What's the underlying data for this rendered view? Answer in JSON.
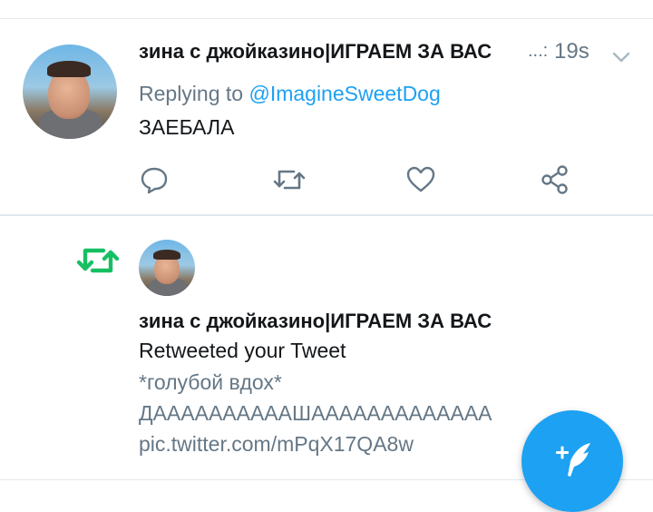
{
  "tweet": {
    "author_name": "зина с джойказино|ИГРАЕМ ЗА ВАС",
    "ellipsis": "...:",
    "timestamp": "19s",
    "replying_prefix": "Replying to",
    "replying_handle": "@ImagineSweetDog",
    "text": "ЗАЕБАЛА",
    "actions": [
      "reply-icon",
      "retweet-icon",
      "like-icon",
      "share-icon"
    ]
  },
  "notification": {
    "type_icon": "retweet-icon",
    "author_name": "зина с джойказино|ИГРАЕМ ЗА ВАС",
    "action_text": "Retweeted your Tweet",
    "quoted_line1": "*голубой вдох*",
    "quoted_line2": "ДААААААААААШААААААААААААА",
    "quoted_line3": "pic.twitter.com/mPqX17QA8w"
  },
  "fab": {
    "icon": "compose-tweet-icon"
  },
  "colors": {
    "accent": "#1da1f2",
    "retweet_green": "#17bf63",
    "muted": "#657786",
    "divider": "#e1e8ed"
  }
}
